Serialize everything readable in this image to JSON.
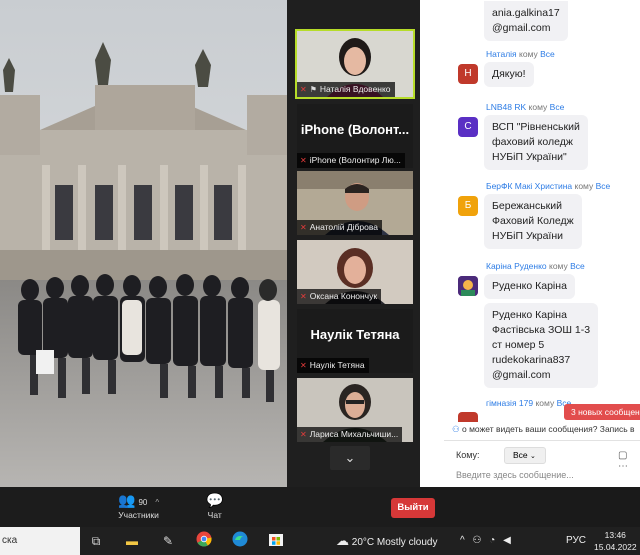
{
  "gallery": {
    "tiles": [
      {
        "name": "Наталія Вдовенко"
      },
      {
        "name": "iPhone (Волонтир Лю...",
        "big": "iPhone  (Волонт..."
      },
      {
        "name": "Анатолій Діброва"
      },
      {
        "name": "Оксана Конончук"
      },
      {
        "name": "Наулік Тетяна",
        "big": "Наулік Тетяна"
      },
      {
        "name": "Лариса  Михальчиши..."
      }
    ],
    "scroll_icon": "chevron-down"
  },
  "chat": {
    "messages": [
      {
        "lines": [
          "ania.galkina17",
          "@gmail.com"
        ]
      },
      {
        "sender": "Наталія",
        "to_label": "кому",
        "recipient": "Все",
        "avatar": "Н",
        "avatar_color": "#c0392b",
        "lines": [
          "Дякую!"
        ]
      },
      {
        "sender": "LNB48 RK",
        "to_label": "кому",
        "recipient": "Все",
        "avatar": "С",
        "avatar_color": "#5a2fc4",
        "lines": [
          "ВСП \"Рівненський",
          "фаховий коледж",
          "НУБіП України\""
        ]
      },
      {
        "sender": "БерФК Макі Христина",
        "to_label": "кому",
        "recipient": "Все",
        "avatar": "Б",
        "avatar_color": "#f0a20b",
        "lines": [
          "Бережанський",
          "Фаховий Коледж",
          "НУБіП України"
        ]
      },
      {
        "sender": "Каріна Руденко",
        "to_label": "кому",
        "recipient": "Все",
        "avatar": "",
        "avatar_color": "#6a3fa0",
        "lines": [
          "Руденко Каріна"
        ]
      },
      {
        "lines": [
          "Руденко Каріна",
          "Фастівська ЗОШ 1-3",
          "ст номер 5",
          "rudekokarina837",
          "@gmail.com"
        ]
      },
      {
        "sender": "гімназія 179",
        "to_label": "кому",
        "recipient": "Все",
        "avatar": "",
        "avatar_color": "#c0392b",
        "lines": []
      }
    ],
    "new_messages_badge": "3 новых сообщени",
    "visibility_notice": "о может видеть ваши сообщения? Запись в",
    "to_label": "Кому:",
    "to_value": "Все",
    "input_placeholder": "Введите здесь сообщение..."
  },
  "toolbar": {
    "participants_count": "90",
    "participants_label": "Участники",
    "chat_label": "Чат",
    "leave_label": "Выйти"
  },
  "taskbar": {
    "search_text": "ска",
    "weather": "20°C  Mostly cloudy",
    "language": "РУС",
    "time": "13:46",
    "date": "15.04.2022"
  }
}
